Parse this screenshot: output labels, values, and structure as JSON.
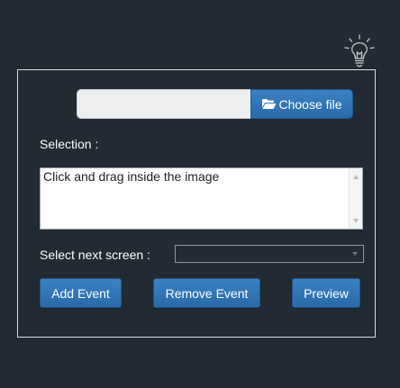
{
  "file_picker": {
    "filename": "",
    "button_label": "Choose file",
    "button_icon": "folder-open-icon"
  },
  "selection": {
    "label": "Selection :",
    "value": "Click and drag inside the image"
  },
  "next_screen": {
    "label": "Select next screen :",
    "selected": ""
  },
  "actions": {
    "add_label": "Add Event",
    "remove_label": "Remove Event",
    "preview_label": "Preview"
  },
  "header": {
    "hint_icon": "lightbulb-icon"
  },
  "colors": {
    "background": "#222a33",
    "button": "#2f76b8",
    "panel_border": "#d9dde1"
  }
}
